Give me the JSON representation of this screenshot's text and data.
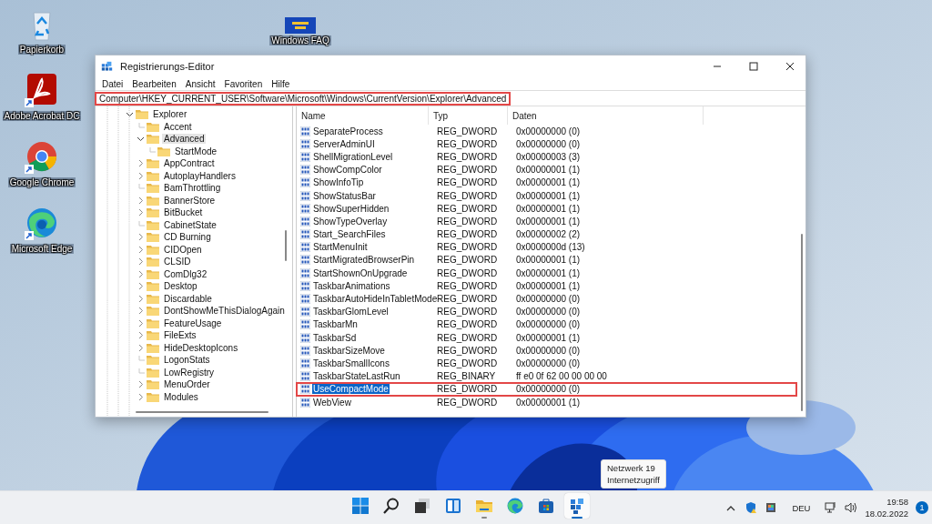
{
  "desktop": {
    "icons": [
      {
        "kind": "recycle",
        "label": "Papierkorb"
      },
      {
        "kind": "acrobat",
        "label": "Adobe Acrobat DC"
      },
      {
        "kind": "chrome",
        "label": "Google Chrome"
      },
      {
        "kind": "edge",
        "label": "Microsoft Edge"
      }
    ],
    "tile": {
      "label": "Windows FAQ"
    }
  },
  "window": {
    "title": "Registrierungs-Editor",
    "menu": [
      "Datei",
      "Bearbeiten",
      "Ansicht",
      "Favoriten",
      "Hilfe"
    ],
    "address": {
      "text": "Computer\\HKEY_CURRENT_USER\\Software\\Microsoft\\Windows\\CurrentVersion\\Explorer\\Advanced",
      "highlighted": true
    },
    "tree": {
      "items": [
        {
          "label": "Explorer",
          "kind": "node",
          "expanded": true,
          "selected": false,
          "children": [
            {
              "label": "Accent",
              "kind": "leaf",
              "selected": false
            },
            {
              "label": "Advanced",
              "kind": "node",
              "expanded": true,
              "selected": true,
              "children": [
                {
                  "label": "StartMode",
                  "kind": "leaf",
                  "selected": false
                }
              ]
            },
            {
              "label": "AppContract",
              "kind": "node",
              "expanded": false,
              "selected": false
            },
            {
              "label": "AutoplayHandlers",
              "kind": "node",
              "expanded": false,
              "selected": false
            },
            {
              "label": "BamThrottling",
              "kind": "leaf",
              "selected": false
            },
            {
              "label": "BannerStore",
              "kind": "node",
              "expanded": false,
              "selected": false
            },
            {
              "label": "BitBucket",
              "kind": "node",
              "expanded": false,
              "selected": false
            },
            {
              "label": "CabinetState",
              "kind": "leaf",
              "selected": false
            },
            {
              "label": "CD Burning",
              "kind": "node",
              "expanded": false,
              "selected": false
            },
            {
              "label": "CIDOpen",
              "kind": "node",
              "expanded": false,
              "selected": false
            },
            {
              "label": "CLSID",
              "kind": "node",
              "expanded": false,
              "selected": false
            },
            {
              "label": "ComDlg32",
              "kind": "node",
              "expanded": false,
              "selected": false
            },
            {
              "label": "Desktop",
              "kind": "node",
              "expanded": false,
              "selected": false
            },
            {
              "label": "Discardable",
              "kind": "node",
              "expanded": false,
              "selected": false
            },
            {
              "label": "DontShowMeThisDialogAgain",
              "kind": "node",
              "expanded": false,
              "selected": false
            },
            {
              "label": "FeatureUsage",
              "kind": "node",
              "expanded": false,
              "selected": false
            },
            {
              "label": "FileExts",
              "kind": "node",
              "expanded": false,
              "selected": false
            },
            {
              "label": "HideDesktopIcons",
              "kind": "node",
              "expanded": false,
              "selected": false
            },
            {
              "label": "LogonStats",
              "kind": "leaf",
              "selected": false
            },
            {
              "label": "LowRegistry",
              "kind": "leaf",
              "selected": false
            },
            {
              "label": "MenuOrder",
              "kind": "node",
              "expanded": false,
              "selected": false
            },
            {
              "label": "Modules",
              "kind": "node",
              "expanded": false,
              "selected": false
            }
          ]
        }
      ]
    },
    "list": {
      "columns": [
        "Name",
        "Typ",
        "Daten"
      ],
      "rows": [
        {
          "name": "SeparateProcess",
          "type": "REG_DWORD",
          "data": "0x00000000 (0)",
          "selected": false,
          "highlighted": false
        },
        {
          "name": "ServerAdminUI",
          "type": "REG_DWORD",
          "data": "0x00000000 (0)",
          "selected": false,
          "highlighted": false
        },
        {
          "name": "ShellMigrationLevel",
          "type": "REG_DWORD",
          "data": "0x00000003 (3)",
          "selected": false,
          "highlighted": false
        },
        {
          "name": "ShowCompColor",
          "type": "REG_DWORD",
          "data": "0x00000001 (1)",
          "selected": false,
          "highlighted": false
        },
        {
          "name": "ShowInfoTip",
          "type": "REG_DWORD",
          "data": "0x00000001 (1)",
          "selected": false,
          "highlighted": false
        },
        {
          "name": "ShowStatusBar",
          "type": "REG_DWORD",
          "data": "0x00000001 (1)",
          "selected": false,
          "highlighted": false
        },
        {
          "name": "ShowSuperHidden",
          "type": "REG_DWORD",
          "data": "0x00000001 (1)",
          "selected": false,
          "highlighted": false
        },
        {
          "name": "ShowTypeOverlay",
          "type": "REG_DWORD",
          "data": "0x00000001 (1)",
          "selected": false,
          "highlighted": false
        },
        {
          "name": "Start_SearchFiles",
          "type": "REG_DWORD",
          "data": "0x00000002 (2)",
          "selected": false,
          "highlighted": false
        },
        {
          "name": "StartMenuInit",
          "type": "REG_DWORD",
          "data": "0x0000000d (13)",
          "selected": false,
          "highlighted": false
        },
        {
          "name": "StartMigratedBrowserPin",
          "type": "REG_DWORD",
          "data": "0x00000001 (1)",
          "selected": false,
          "highlighted": false
        },
        {
          "name": "StartShownOnUpgrade",
          "type": "REG_DWORD",
          "data": "0x00000001 (1)",
          "selected": false,
          "highlighted": false
        },
        {
          "name": "TaskbarAnimations",
          "type": "REG_DWORD",
          "data": "0x00000001 (1)",
          "selected": false,
          "highlighted": false
        },
        {
          "name": "TaskbarAutoHideInTabletMode",
          "type": "REG_DWORD",
          "data": "0x00000000 (0)",
          "selected": false,
          "highlighted": false
        },
        {
          "name": "TaskbarGlomLevel",
          "type": "REG_DWORD",
          "data": "0x00000000 (0)",
          "selected": false,
          "highlighted": false
        },
        {
          "name": "TaskbarMn",
          "type": "REG_DWORD",
          "data": "0x00000000 (0)",
          "selected": false,
          "highlighted": false
        },
        {
          "name": "TaskbarSd",
          "type": "REG_DWORD",
          "data": "0x00000001 (1)",
          "selected": false,
          "highlighted": false
        },
        {
          "name": "TaskbarSizeMove",
          "type": "REG_DWORD",
          "data": "0x00000000 (0)",
          "selected": false,
          "highlighted": false
        },
        {
          "name": "TaskbarSmallIcons",
          "type": "REG_DWORD",
          "data": "0x00000000 (0)",
          "selected": false,
          "highlighted": false
        },
        {
          "name": "TaskbarStateLastRun",
          "type": "REG_BINARY",
          "data": "ff e0 0f 62 00 00 00 00",
          "selected": false,
          "highlighted": false
        },
        {
          "name": "UseCompactMode",
          "type": "REG_DWORD",
          "data": "0x00000000 (0)",
          "selected": true,
          "highlighted": true
        },
        {
          "name": "WebView",
          "type": "REG_DWORD",
          "data": "0x00000001 (1)",
          "selected": false,
          "highlighted": false
        }
      ]
    }
  },
  "tooltip": {
    "lines": [
      "Netzwerk 19",
      "Internetzugriff"
    ]
  },
  "taskbar": {
    "apps": [
      {
        "kind": "start",
        "selected": false,
        "running": false
      },
      {
        "kind": "search",
        "selected": false,
        "running": false
      },
      {
        "kind": "taskview",
        "selected": false,
        "running": false
      },
      {
        "kind": "widgets",
        "selected": false,
        "running": false
      },
      {
        "kind": "explorer",
        "selected": false,
        "running": true
      },
      {
        "kind": "edge",
        "selected": false,
        "running": false
      },
      {
        "kind": "store",
        "selected": false,
        "running": false
      },
      {
        "kind": "regedit",
        "selected": true,
        "running": true
      }
    ],
    "tray": {
      "language": "DEU",
      "time": "19:58",
      "date": "18.02.2022",
      "badge": "1"
    }
  }
}
